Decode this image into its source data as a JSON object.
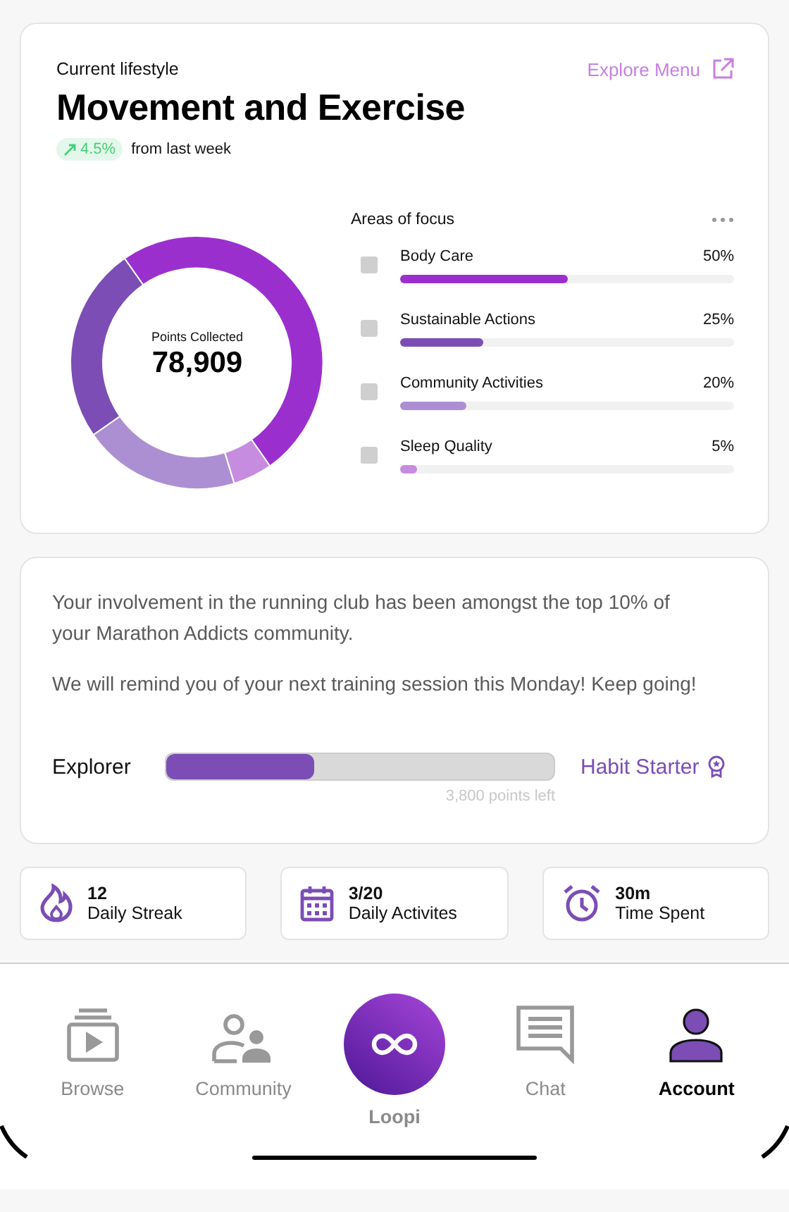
{
  "lifestyle": {
    "eyebrow": "Current lifestyle",
    "explore_link": "Explore Menu",
    "title": "Movement and Exercise",
    "trend": {
      "value": "4.5%"
    },
    "trend_caption": "from last week",
    "chart_data": {
      "type": "donut",
      "values": [
        50,
        25,
        20,
        5
      ]
    },
    "center_label": "Points Collected",
    "center_value": "78,909",
    "focus_title": "Areas of focus",
    "areas": [
      {
        "label": "Body Care",
        "percent": "50%",
        "level": 0.5,
        "color": "#9b2fce",
        "checked": false
      },
      {
        "label": "Sustainable Actions",
        "percent": "25%",
        "level": 0.25,
        "color": "#7b4db5",
        "checked": false
      },
      {
        "label": "Community Activities",
        "percent": "20%",
        "level": 0.2,
        "color": "#ac8fd2",
        "checked": false
      },
      {
        "label": "Sleep Quality",
        "percent": "5%",
        "level": 0.05,
        "color": "#c68ce0",
        "checked": false
      }
    ]
  },
  "message": {
    "paragraphs": [
      "Your involvement in the running club has been amongst the top 10% of your Marathon Addicts community.",
      "We will remind you of your next training session this Monday! Keep going!"
    ],
    "progress": {
      "current": "Explorer",
      "next": "Habit Starter",
      "level": 0.38,
      "remaining": "3,800 points left"
    }
  },
  "stats": [
    {
      "kind": "flame",
      "value": "12",
      "label": "Daily Streak"
    },
    {
      "kind": "calendar",
      "value": "3/20",
      "label": "Daily Activites"
    },
    {
      "kind": "alarm",
      "value": "30m",
      "label": "Time Spent"
    }
  ],
  "nav": [
    {
      "kind": "browse",
      "label": "Browse",
      "selected": false
    },
    {
      "kind": "community",
      "label": "Community",
      "selected": false
    },
    {
      "kind": "loopi",
      "label": "Loopi",
      "selected": false
    },
    {
      "kind": "chat",
      "label": "Chat",
      "selected": false
    },
    {
      "kind": "account",
      "label": "Account",
      "selected": true
    }
  ]
}
